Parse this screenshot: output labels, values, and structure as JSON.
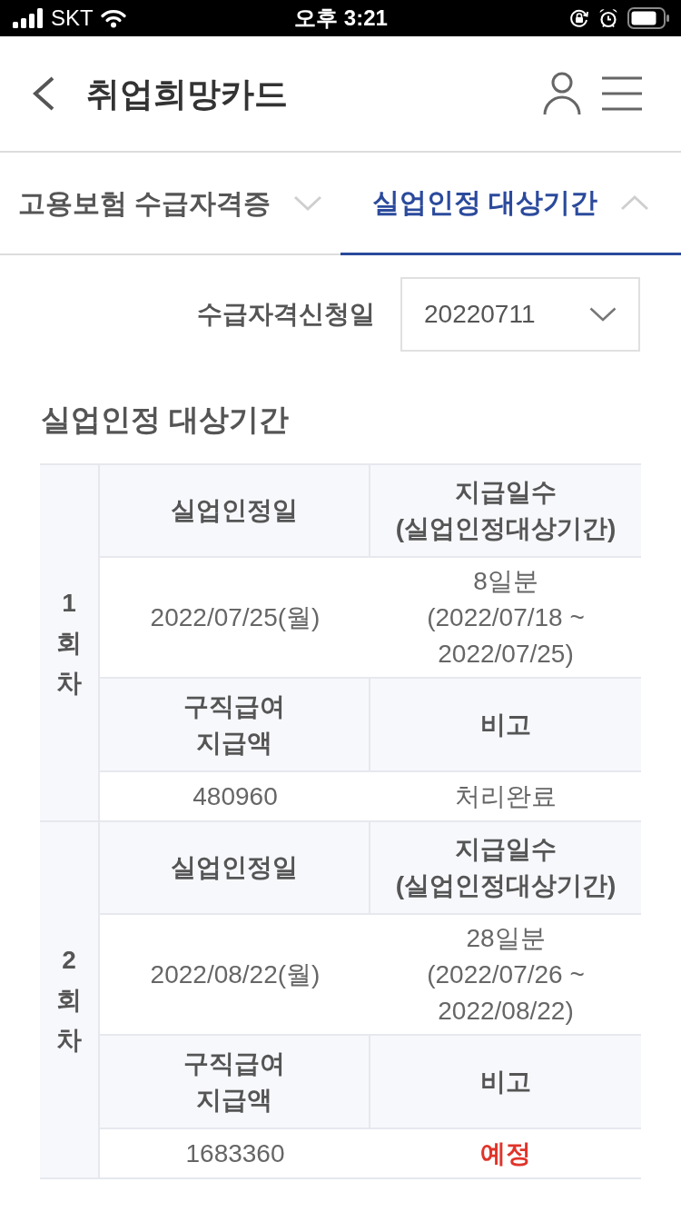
{
  "status_bar": {
    "carrier": "SKT",
    "time": "오후 3:21"
  },
  "header": {
    "title": "취업희망카드"
  },
  "tabs": [
    {
      "label": "고용보험 수급자격증",
      "selected": false,
      "expanded": false
    },
    {
      "label": "실업인정 대상기간",
      "selected": true,
      "expanded": true
    }
  ],
  "filter": {
    "label": "수급자격신청일",
    "value": "20220711"
  },
  "section": {
    "title": "실업인정 대상기간",
    "rounds": [
      {
        "label": "1회차",
        "header_top": [
          "실업인정일",
          "지급일수\n(실업인정대상기간)"
        ],
        "recognition_date": "2022/07/25(월)",
        "payment_days": "8일분\n(2022/07/18 ~\n2022/07/25)",
        "header_bottom": [
          "구직급여\n지급액",
          "비고"
        ],
        "amount": "480960",
        "note": "처리완료",
        "note_highlighted": false
      },
      {
        "label": "2회차",
        "header_top": [
          "실업인정일",
          "지급일수\n(실업인정대상기간)"
        ],
        "recognition_date": "2022/08/22(월)",
        "payment_days": "28일분\n(2022/07/26 ~\n2022/08/22)",
        "header_bottom": [
          "구직급여\n지급액",
          "비고"
        ],
        "amount": "1683360",
        "note": "예정",
        "note_highlighted": true
      }
    ]
  }
}
